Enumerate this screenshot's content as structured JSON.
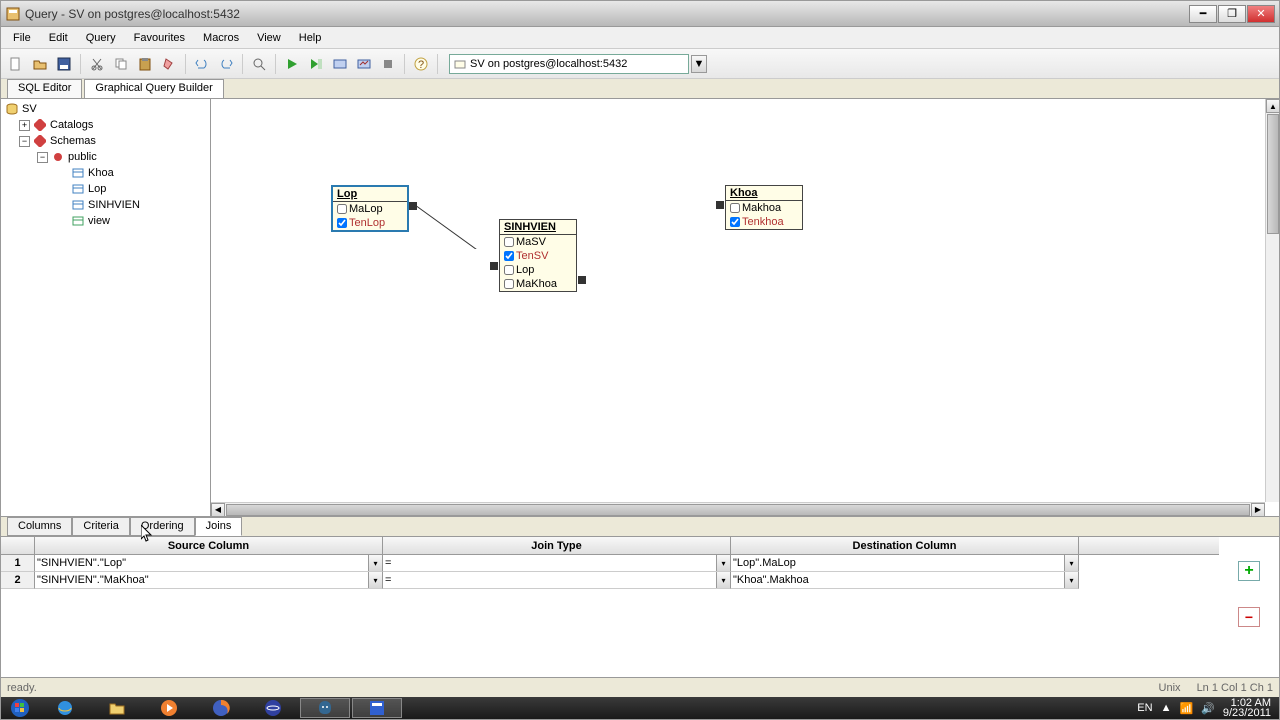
{
  "window": {
    "title": "Query - SV on postgres@localhost:5432"
  },
  "menu": {
    "file": "File",
    "edit": "Edit",
    "query": "Query",
    "favourites": "Favourites",
    "macros": "Macros",
    "view": "View",
    "help": "Help"
  },
  "toolbar": {
    "db_selected": "SV on postgres@localhost:5432"
  },
  "editor_tabs": {
    "sql": "SQL Editor",
    "gqb": "Graphical Query Builder"
  },
  "tree": {
    "root": "SV",
    "catalogs": "Catalogs",
    "schemas": "Schemas",
    "public": "public",
    "tables": {
      "khoa": "Khoa",
      "lop": "Lop",
      "sinhvien": "SINHVIEN",
      "view": "view"
    }
  },
  "canvas": {
    "tables": {
      "lop": {
        "title": "Lop",
        "cols": [
          {
            "name": "MaLop",
            "checked": false
          },
          {
            "name": "TenLop",
            "checked": true
          }
        ]
      },
      "sinhvien": {
        "title": "SINHVIEN",
        "cols": [
          {
            "name": "MaSV",
            "checked": false
          },
          {
            "name": "TenSV",
            "checked": true
          },
          {
            "name": "Lop",
            "checked": false
          },
          {
            "name": "MaKhoa",
            "checked": false
          }
        ]
      },
      "khoa": {
        "title": "Khoa",
        "cols": [
          {
            "name": "Makhoa",
            "checked": false
          },
          {
            "name": "Tenkhoa",
            "checked": true
          }
        ]
      }
    },
    "join_label": "="
  },
  "bottom_tabs": {
    "columns": "Columns",
    "criteria": "Criteria",
    "ordering": "Ordering",
    "joins": "Joins"
  },
  "grid": {
    "headers": {
      "rownum": "",
      "source": "Source Column",
      "jointype": "Join Type",
      "dest": "Destination Column"
    },
    "rows": [
      {
        "num": "1",
        "source": "\"SINHVIEN\".\"Lop\"",
        "jointype": "=",
        "dest": "\"Lop\".MaLop"
      },
      {
        "num": "2",
        "source": "\"SINHVIEN\".\"MaKhoa\"",
        "jointype": "=",
        "dest": "\"Khoa\".Makhoa"
      }
    ]
  },
  "status": {
    "ready": "ready.",
    "mode": "Unix",
    "pos": "Ln 1 Col 1 Ch 1"
  },
  "tray": {
    "lang": "EN",
    "time": "1:02 AM",
    "date": "9/23/2011"
  }
}
